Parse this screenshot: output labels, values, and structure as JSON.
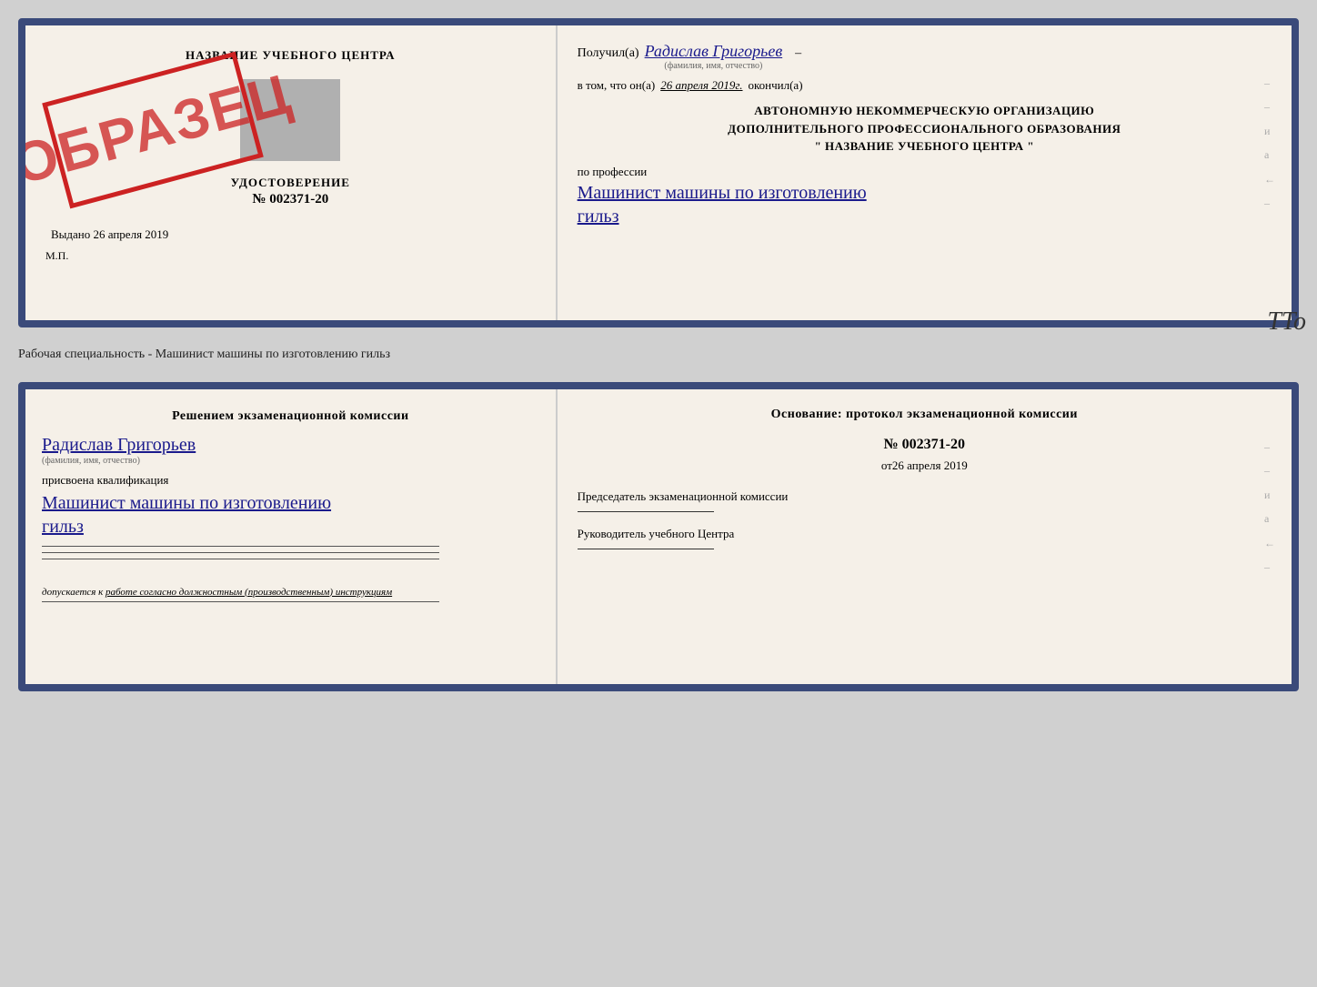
{
  "top_doc": {
    "left": {
      "school_name": "НАЗВАНИЕ УЧЕБНОГО ЦЕНТРА",
      "udostoverenie_title": "УДОСТОВЕРЕНИЕ",
      "udostoverenie_num": "№ 002371-20",
      "vydano_label": "Выдано",
      "vydano_date": "26 апреля 2019",
      "mp_label": "М.П.",
      "obrazec": "ОБРАЗЕЦ"
    },
    "right": {
      "poluchil_label": "Получил(а)",
      "recipient_name": "Радислав Григорьев",
      "fio_subtitle": "(фамилия, имя, отчество)",
      "vtom_prefix": "в том, что он(а)",
      "vtom_date": "26 апреля 2019г.",
      "okonchil_label": "окончил(а)",
      "org_line1": "АВТОНОМНУЮ НЕКОММЕРЧЕСКУЮ ОРГАНИЗАЦИЮ",
      "org_line2": "ДОПОЛНИТЕЛЬНОГО ПРОФЕССИОНАЛЬНОГО ОБРАЗОВАНИЯ",
      "org_name": "\" НАЗВАНИЕ УЧЕБНОГО ЦЕНТРА \"",
      "po_professii_label": "по профессии",
      "profession_line1": "Машинист машины по изготовлению",
      "profession_line2": "гильз",
      "dash1": "–",
      "dash2": "–",
      "dash3": "–",
      "i_label": "и",
      "a_label": "а",
      "arrow_label": "←"
    }
  },
  "separator": {
    "label": "Рабочая специальность - Машинист машины по изготовлению гильз"
  },
  "bottom_doc": {
    "left": {
      "resheniem_title": "Решением экзаменационной комиссии",
      "name": "Радислав Григорьев",
      "fio_subtitle": "(фамилия, имя, отчество)",
      "prisvoena_label": "присвоена квалификация",
      "qualification_line1": "Машинист машины по изготовлению",
      "qualification_line2": "гильз",
      "dopuskaetsya_prefix": "допускается к",
      "dopuskaetsya_text": "работе согласно должностным (производственным) инструкциям"
    },
    "right": {
      "osnovanie_title": "Основание: протокол экзаменационной комиссии",
      "protocol_num": "№ 002371-20",
      "ot_prefix": "от",
      "protocol_date": "26 апреля 2019",
      "predsedatel_label": "Председатель экзаменационной комиссии",
      "rukovoditel_label": "Руководитель учебного Центра",
      "dash1": "–",
      "dash2": "–",
      "dash3": "–",
      "i_label": "и",
      "a_label": "а",
      "arrow_label": "←"
    }
  },
  "tto_text": "TTo"
}
